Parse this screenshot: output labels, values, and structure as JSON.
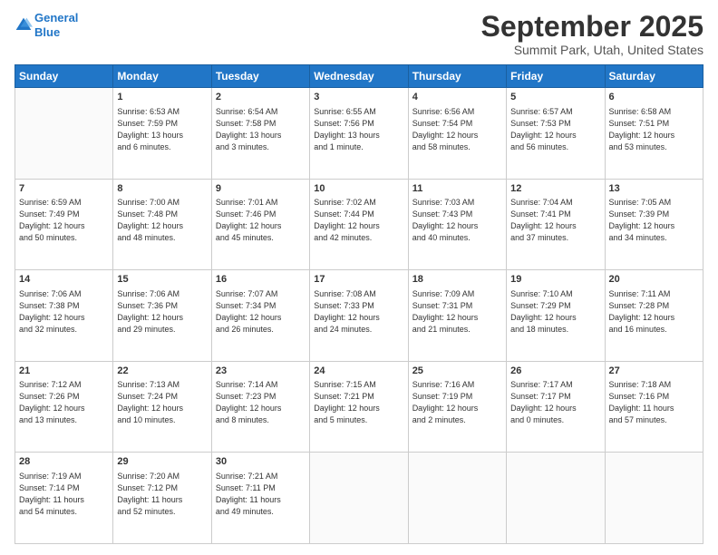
{
  "logo": {
    "line1": "General",
    "line2": "Blue"
  },
  "header": {
    "title": "September 2025",
    "subtitle": "Summit Park, Utah, United States"
  },
  "days_of_week": [
    "Sunday",
    "Monday",
    "Tuesday",
    "Wednesday",
    "Thursday",
    "Friday",
    "Saturday"
  ],
  "weeks": [
    [
      {
        "num": "",
        "info": ""
      },
      {
        "num": "1",
        "info": "Sunrise: 6:53 AM\nSunset: 7:59 PM\nDaylight: 13 hours\nand 6 minutes."
      },
      {
        "num": "2",
        "info": "Sunrise: 6:54 AM\nSunset: 7:58 PM\nDaylight: 13 hours\nand 3 minutes."
      },
      {
        "num": "3",
        "info": "Sunrise: 6:55 AM\nSunset: 7:56 PM\nDaylight: 13 hours\nand 1 minute."
      },
      {
        "num": "4",
        "info": "Sunrise: 6:56 AM\nSunset: 7:54 PM\nDaylight: 12 hours\nand 58 minutes."
      },
      {
        "num": "5",
        "info": "Sunrise: 6:57 AM\nSunset: 7:53 PM\nDaylight: 12 hours\nand 56 minutes."
      },
      {
        "num": "6",
        "info": "Sunrise: 6:58 AM\nSunset: 7:51 PM\nDaylight: 12 hours\nand 53 minutes."
      }
    ],
    [
      {
        "num": "7",
        "info": "Sunrise: 6:59 AM\nSunset: 7:49 PM\nDaylight: 12 hours\nand 50 minutes."
      },
      {
        "num": "8",
        "info": "Sunrise: 7:00 AM\nSunset: 7:48 PM\nDaylight: 12 hours\nand 48 minutes."
      },
      {
        "num": "9",
        "info": "Sunrise: 7:01 AM\nSunset: 7:46 PM\nDaylight: 12 hours\nand 45 minutes."
      },
      {
        "num": "10",
        "info": "Sunrise: 7:02 AM\nSunset: 7:44 PM\nDaylight: 12 hours\nand 42 minutes."
      },
      {
        "num": "11",
        "info": "Sunrise: 7:03 AM\nSunset: 7:43 PM\nDaylight: 12 hours\nand 40 minutes."
      },
      {
        "num": "12",
        "info": "Sunrise: 7:04 AM\nSunset: 7:41 PM\nDaylight: 12 hours\nand 37 minutes."
      },
      {
        "num": "13",
        "info": "Sunrise: 7:05 AM\nSunset: 7:39 PM\nDaylight: 12 hours\nand 34 minutes."
      }
    ],
    [
      {
        "num": "14",
        "info": "Sunrise: 7:06 AM\nSunset: 7:38 PM\nDaylight: 12 hours\nand 32 minutes."
      },
      {
        "num": "15",
        "info": "Sunrise: 7:06 AM\nSunset: 7:36 PM\nDaylight: 12 hours\nand 29 minutes."
      },
      {
        "num": "16",
        "info": "Sunrise: 7:07 AM\nSunset: 7:34 PM\nDaylight: 12 hours\nand 26 minutes."
      },
      {
        "num": "17",
        "info": "Sunrise: 7:08 AM\nSunset: 7:33 PM\nDaylight: 12 hours\nand 24 minutes."
      },
      {
        "num": "18",
        "info": "Sunrise: 7:09 AM\nSunset: 7:31 PM\nDaylight: 12 hours\nand 21 minutes."
      },
      {
        "num": "19",
        "info": "Sunrise: 7:10 AM\nSunset: 7:29 PM\nDaylight: 12 hours\nand 18 minutes."
      },
      {
        "num": "20",
        "info": "Sunrise: 7:11 AM\nSunset: 7:28 PM\nDaylight: 12 hours\nand 16 minutes."
      }
    ],
    [
      {
        "num": "21",
        "info": "Sunrise: 7:12 AM\nSunset: 7:26 PM\nDaylight: 12 hours\nand 13 minutes."
      },
      {
        "num": "22",
        "info": "Sunrise: 7:13 AM\nSunset: 7:24 PM\nDaylight: 12 hours\nand 10 minutes."
      },
      {
        "num": "23",
        "info": "Sunrise: 7:14 AM\nSunset: 7:23 PM\nDaylight: 12 hours\nand 8 minutes."
      },
      {
        "num": "24",
        "info": "Sunrise: 7:15 AM\nSunset: 7:21 PM\nDaylight: 12 hours\nand 5 minutes."
      },
      {
        "num": "25",
        "info": "Sunrise: 7:16 AM\nSunset: 7:19 PM\nDaylight: 12 hours\nand 2 minutes."
      },
      {
        "num": "26",
        "info": "Sunrise: 7:17 AM\nSunset: 7:17 PM\nDaylight: 12 hours\nand 0 minutes."
      },
      {
        "num": "27",
        "info": "Sunrise: 7:18 AM\nSunset: 7:16 PM\nDaylight: 11 hours\nand 57 minutes."
      }
    ],
    [
      {
        "num": "28",
        "info": "Sunrise: 7:19 AM\nSunset: 7:14 PM\nDaylight: 11 hours\nand 54 minutes."
      },
      {
        "num": "29",
        "info": "Sunrise: 7:20 AM\nSunset: 7:12 PM\nDaylight: 11 hours\nand 52 minutes."
      },
      {
        "num": "30",
        "info": "Sunrise: 7:21 AM\nSunset: 7:11 PM\nDaylight: 11 hours\nand 49 minutes."
      },
      {
        "num": "",
        "info": ""
      },
      {
        "num": "",
        "info": ""
      },
      {
        "num": "",
        "info": ""
      },
      {
        "num": "",
        "info": ""
      }
    ]
  ]
}
